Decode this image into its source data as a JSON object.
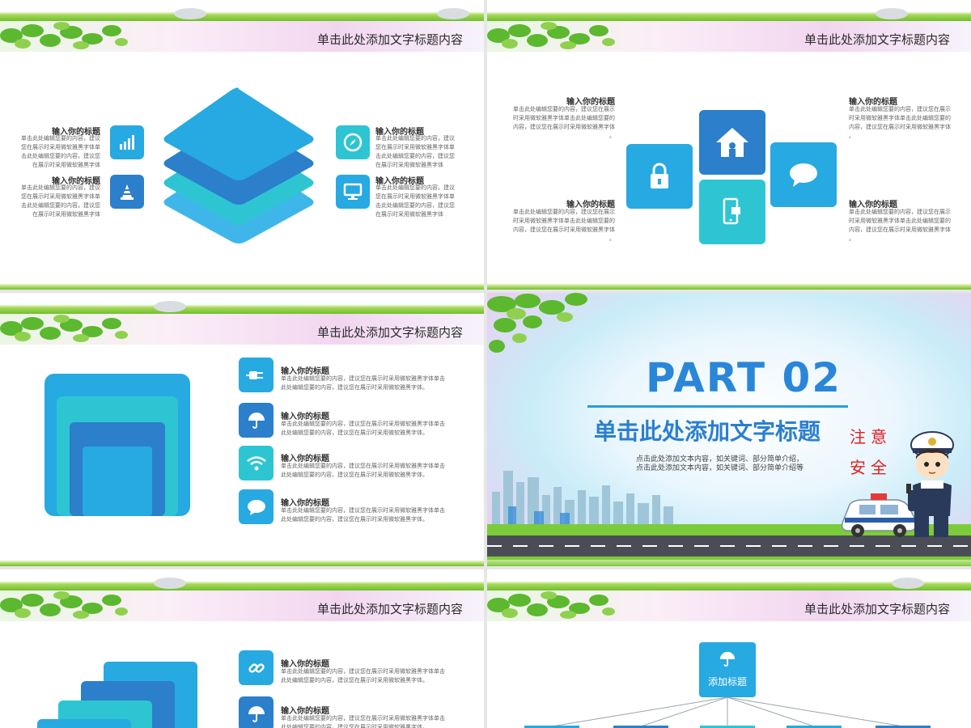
{
  "header_title": "单击此处添加文字标题内容",
  "input_title": "输入你的标题",
  "slide1": {
    "left_texts": [
      "单击此处编辑您要的内容，建议\n您在展示时采用微软雅黑字体单\n击此处编辑您要的内容，建议您\n在展示时采用微软雅黑字体",
      "单击此处编辑您要的内容，建议\n您在展示时采用微软雅黑字体单\n击此处编辑您要的内容，建议您\n在展示时采用微软雅黑字体"
    ],
    "right_texts": [
      "单击此处编辑您要的内容，建议\n您在展示时采用微软雅黑字体单\n击此处编辑您要的内容，建议您\n在展示时采用微软雅黑字体",
      "单击此处编辑您要的内容，建议\n您在展示时采用微软雅黑字体单\n击此处编辑您要的内容，建议您\n在展示时采用微软雅黑字体"
    ]
  },
  "slide2": {
    "text": "单击此处编辑您要的内容，建议您在展示\n时采用微软雅黑字体单击此处编辑您要的\n内容，建议您在展示时采用微软雅黑字体\n。"
  },
  "slide3": {
    "text": "单击此处编辑您要的内容，建议您在展示时采用微软雅黑字体单击\n此处编辑您要的内容，建议您在展示时采用微软雅黑字体。"
  },
  "slide4": {
    "part": "PART 02",
    "subtitle": "单击此处添加文字标题",
    "desc": "点击此处添加文本内容，如关键词、部分简单介绍，\n点击此处添加文本内容，如关键词、部分简单介绍等",
    "red1": "注意",
    "red2": "安全"
  },
  "slide6": {
    "box_label": "添加标题"
  },
  "colors": {
    "blue": "#27a9e1",
    "dark_blue": "#2b7fcb",
    "cyan": "#2ec5d3",
    "light_blue": "#3fb6ea"
  }
}
